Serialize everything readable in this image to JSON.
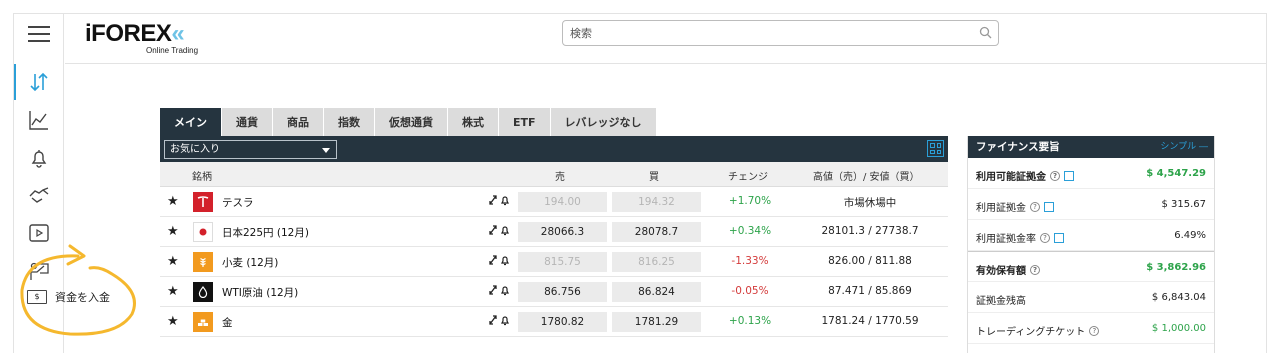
{
  "search": {
    "placeholder": "検索"
  },
  "logo": {
    "main": "iFOREX",
    "sub": "Online Trading"
  },
  "tabs": [
    "メイン",
    "通貨",
    "商品",
    "指数",
    "仮想通貨",
    "株式",
    "ETF",
    "レバレッジなし"
  ],
  "filter": {
    "selected": "お気に入り"
  },
  "table": {
    "headers": {
      "symbol": "銘柄",
      "sell": "売",
      "buy": "買",
      "change": "チェンジ",
      "highlow": "高値（売）/ 安値（買）"
    },
    "rows": [
      {
        "name": "テスラ",
        "sell": "194.00",
        "buy": "194.32",
        "change": "+1.70%",
        "dir": "up",
        "highlow": "市場休場中",
        "dim": true
      },
      {
        "name": "日本225円 (12月)",
        "sell": "28066.3",
        "buy": "28078.7",
        "change": "+0.34%",
        "dir": "up",
        "highlow": "28101.3 / 27738.7",
        "dim": false
      },
      {
        "name": "小麦 (12月)",
        "sell": "815.75",
        "buy": "816.25",
        "change": "-1.33%",
        "dir": "down",
        "highlow": "826.00 / 811.88",
        "dim": true
      },
      {
        "name": "WTI原油 (12月)",
        "sell": "86.756",
        "buy": "86.824",
        "change": "-0.05%",
        "dir": "down",
        "highlow": "87.471 / 85.869",
        "dim": false
      },
      {
        "name": "金",
        "sell": "1780.82",
        "buy": "1781.29",
        "change": "+0.13%",
        "dir": "up",
        "highlow": "1781.24 / 1770.59",
        "dim": false
      }
    ]
  },
  "finance": {
    "title": "ファイナンス要旨",
    "simple": "シンプル ―",
    "items": [
      {
        "label": "利用可能証拠金",
        "value": "$ 4,547.29"
      },
      {
        "label": "利用証拠金",
        "value": "$ 315.67"
      },
      {
        "label": "利用証拠金率",
        "value": "6.49%"
      },
      {
        "label": "有効保有額",
        "value": "$ 3,862.96"
      },
      {
        "label": "証拠金残高",
        "value": "$ 6,843.04"
      },
      {
        "label": "トレーディングチケット",
        "value": "$ 1,000.00"
      }
    ]
  },
  "deposit": {
    "label": "資金を入金"
  },
  "colors": {
    "dark": "#25343f",
    "accent": "#2a9fd8",
    "up": "#2da34a",
    "down": "#d43b3b",
    "highlight": "#f5b82e"
  }
}
